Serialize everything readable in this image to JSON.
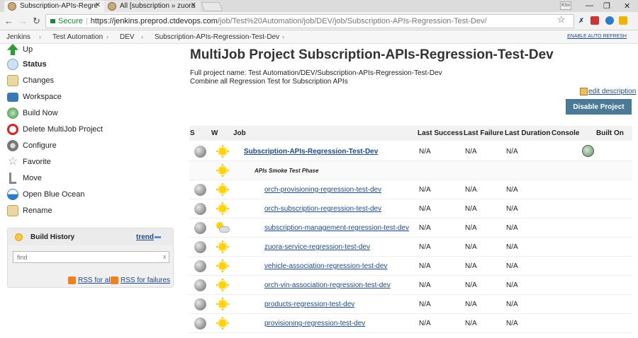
{
  "browser": {
    "tabs": [
      {
        "title": "Subscription-APIs-Regre",
        "active": true
      },
      {
        "title": "All [subscription » zuora",
        "active": false
      }
    ],
    "profile_label": "Ktoi",
    "url": {
      "secure_label": "Secure",
      "host": "https://jenkins.preprod.ctdevops.com",
      "path": "/job/Test%20Automation/job/DEV/job/Subscription-APIs-Regression-Test-Dev/"
    }
  },
  "breadcrumb": {
    "items": [
      "Jenkins",
      "Test Automation",
      "DEV",
      "Subscription-APIs-Regression-Test-Dev"
    ],
    "auto_refresh": "ENABLE AUTO REFRESH"
  },
  "sidebar": {
    "tasks": [
      {
        "label": "Up",
        "icon": "up-arrow-icon",
        "color": "#2e9c34",
        "bold": false
      },
      {
        "label": "Status",
        "icon": "magnifier-icon",
        "color": "#7aa3c8",
        "bold": true
      },
      {
        "label": "Changes",
        "icon": "notepad-icon",
        "color": "#c9a14a",
        "bold": false
      },
      {
        "label": "Workspace",
        "icon": "folder-icon",
        "color": "#3a77b5",
        "bold": false
      },
      {
        "label": "Build Now",
        "icon": "build-clock-icon",
        "color": "#3a8a3a",
        "bold": false
      },
      {
        "label": "Delete MultiJob Project",
        "icon": "no-entry-icon",
        "color": "#d22",
        "bold": false
      },
      {
        "label": "Configure",
        "icon": "gear-icon",
        "color": "#777",
        "bold": false
      },
      {
        "label": "Favorite",
        "icon": "star-icon",
        "color": "#ddd",
        "bold": false
      },
      {
        "label": "Move",
        "icon": "move-icon",
        "color": "#888",
        "bold": false
      },
      {
        "label": "Open Blue Ocean",
        "icon": "blue-ocean-icon",
        "color": "#2f7dc7",
        "bold": false
      },
      {
        "label": "Rename",
        "icon": "notepad-icon",
        "color": "#c9a14a",
        "bold": false
      }
    ],
    "build_history": {
      "title": "Build History",
      "trend": "trend",
      "find_placeholder": "find",
      "find_clear": "x",
      "rss_all": "RSS for all",
      "rss_failures": "RSS for failures"
    }
  },
  "main": {
    "title": "MultiJob Project Subscription-APIs-Regression-Test-Dev",
    "full_name": "Full project name: Test Automation/DEV/Subscription-APIs-Regression-Test-Dev",
    "description": "Combine all Regression Test for Subscription APIs",
    "edit_description": "edit description",
    "disable_button": "Disable Project",
    "table": {
      "headers": [
        "S",
        "W",
        "Job",
        "Last Success",
        "Last Failure",
        "Last Duration",
        "Console",
        "Built On"
      ],
      "rows": [
        {
          "kind": "job",
          "name": "Subscription-APIs-Regression-Test-Dev",
          "top": true,
          "weather": "sunny",
          "last_success": "N/A",
          "last_failure": "N/A",
          "last_duration": "N/A",
          "console": true
        },
        {
          "kind": "phase",
          "name": "APIs Smoke Test Phase",
          "weather": "sunny"
        },
        {
          "kind": "job",
          "name": "orch-provisioning-regression-test-dev",
          "weather": "sunny",
          "last_success": "N/A",
          "last_failure": "N/A",
          "last_duration": "N/A"
        },
        {
          "kind": "job",
          "name": "orch-subscription-regression-test-dev",
          "weather": "sunny",
          "last_success": "N/A",
          "last_failure": "N/A",
          "last_duration": "N/A"
        },
        {
          "kind": "job",
          "name": "subscription-management-regression-test-dev",
          "weather": "cloudy",
          "last_success": "N/A",
          "last_failure": "N/A",
          "last_duration": "N/A"
        },
        {
          "kind": "job",
          "name": "zuora-service-regression-test-dev",
          "weather": "sunny",
          "last_success": "N/A",
          "last_failure": "N/A",
          "last_duration": "N/A"
        },
        {
          "kind": "job",
          "name": "vehicle-association-regression-test-dev",
          "weather": "sunny",
          "last_success": "N/A",
          "last_failure": "N/A",
          "last_duration": "N/A"
        },
        {
          "kind": "job",
          "name": "orch-vin-association-regression-test-dev",
          "weather": "sunny",
          "last_success": "N/A",
          "last_failure": "N/A",
          "last_duration": "N/A"
        },
        {
          "kind": "job",
          "name": "products-regression-test-dev",
          "weather": "sunny",
          "last_success": "N/A",
          "last_failure": "N/A",
          "last_duration": "N/A"
        },
        {
          "kind": "job",
          "name": "provisioning-regression-test-dev",
          "weather": "sunny",
          "last_success": "N/A",
          "last_failure": "N/A",
          "last_duration": "N/A"
        }
      ]
    }
  }
}
